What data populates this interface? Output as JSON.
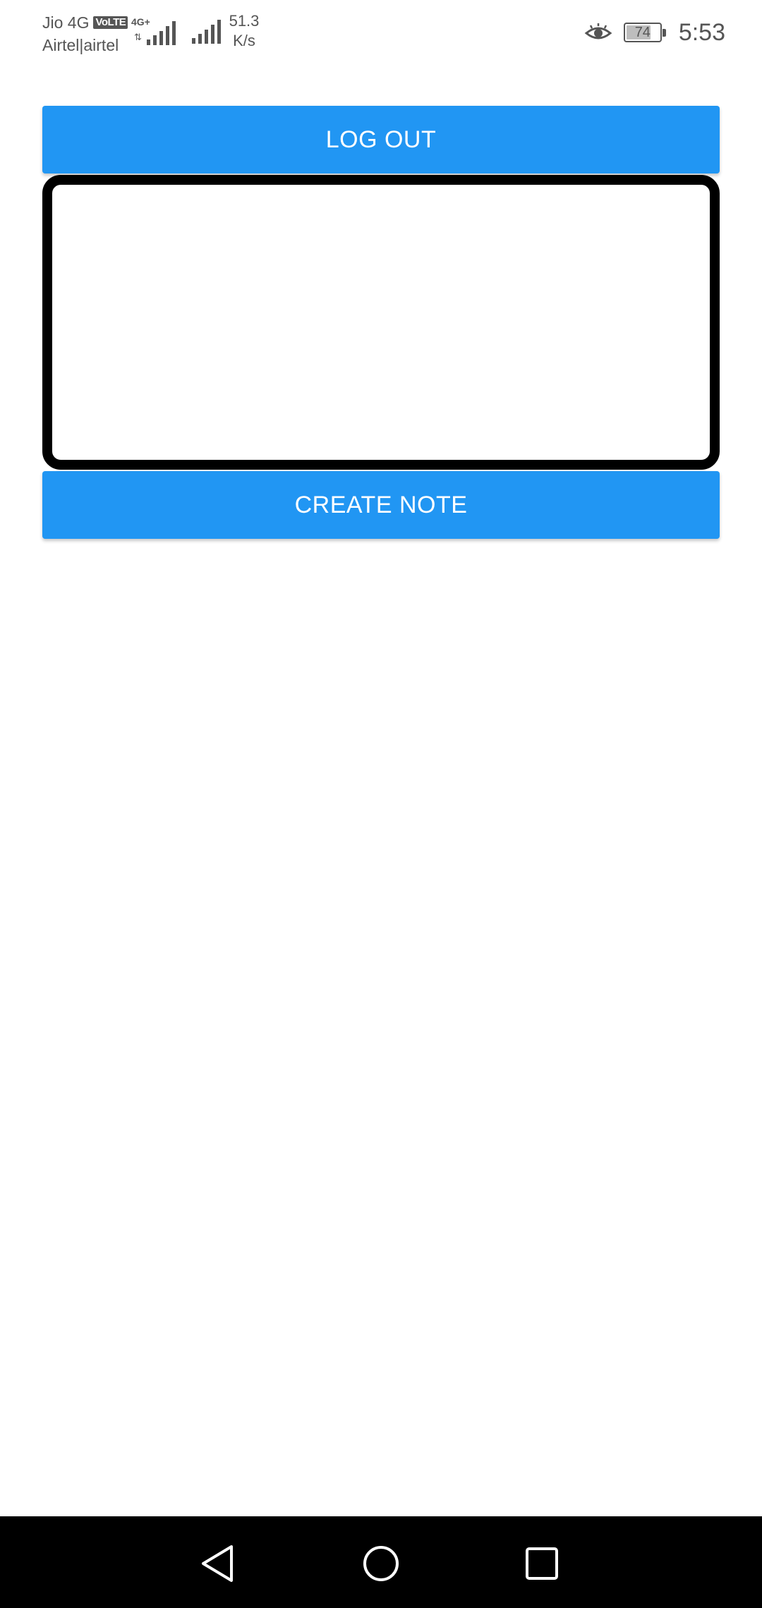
{
  "status_bar": {
    "carrier_primary": "Jio 4G",
    "volte_badge": "VoLTE",
    "carrier_secondary": "Airtel|airtel",
    "signal1_label": "4G+",
    "signal1_arrows": "⇅",
    "speed_value": "51.3",
    "speed_unit": "K/s",
    "battery_level": "74",
    "battery_fraction": 0.74,
    "time": "5:53",
    "icons": [
      "signal-4g-icon",
      "signal-icon",
      "eye-icon",
      "battery-icon"
    ]
  },
  "main": {
    "logout_label": "LOG OUT",
    "note_value": "",
    "note_placeholder": "",
    "create_label": "CREATE NOTE"
  },
  "nav_bar": {
    "icons": [
      "back-icon",
      "home-icon",
      "recent-apps-icon"
    ]
  },
  "colors": {
    "primary_button": "#2196f3",
    "button_text": "#ffffff",
    "input_border": "#000000",
    "status_text": "#555555",
    "nav_bar_bg": "#000000"
  }
}
